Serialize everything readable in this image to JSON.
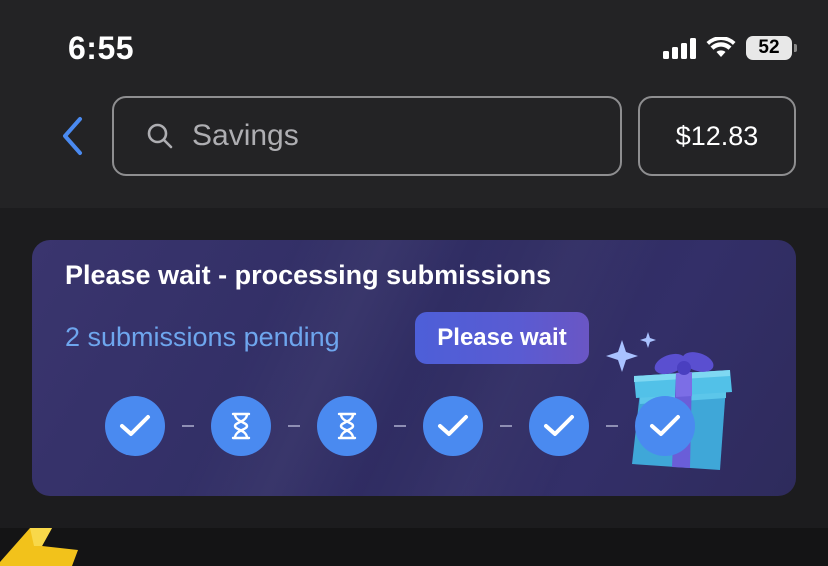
{
  "status_bar": {
    "time": "6:55",
    "battery": "52"
  },
  "header": {
    "search_placeholder": "Savings",
    "balance": "$12.83"
  },
  "card": {
    "title": "Please wait - processing submissions",
    "pending_text": "2 submissions pending",
    "button_label": "Please wait",
    "steps": [
      "check",
      "hourglass",
      "hourglass",
      "check",
      "check",
      "check"
    ]
  },
  "colors": {
    "accent_blue": "#4a8af0",
    "pending_text": "#6ea6ee",
    "card_bg": "#322f66"
  }
}
